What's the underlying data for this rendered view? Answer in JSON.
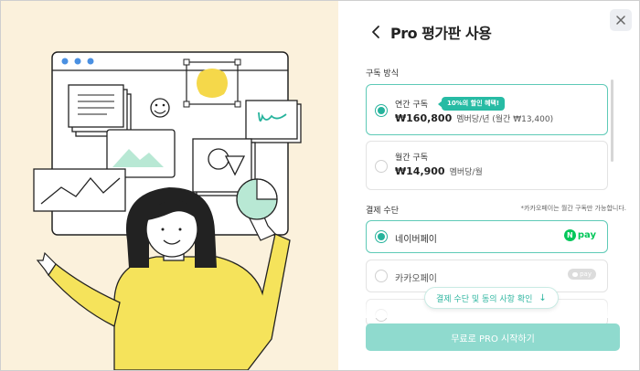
{
  "header": {
    "title": "Pro 평가판 사용"
  },
  "subscription": {
    "label": "구독 방식",
    "options": [
      {
        "name": "연간 구독",
        "badge": "10%의 할인 혜택!",
        "price": "₩160,800",
        "price_sub": "멤버당/년 (월간 ₩13,400)",
        "selected": true
      },
      {
        "name": "월간 구독",
        "price": "₩14,900",
        "price_sub": "멤버당/월",
        "selected": false
      }
    ]
  },
  "payment": {
    "label": "결제 수단",
    "note": "*카카오페이는 월간 구독만 가능합니다.",
    "methods": [
      {
        "name": "네이버페이",
        "logo_letter": "N",
        "logo_text": "pay",
        "selected": true
      },
      {
        "name": "카카오페이",
        "logo_text": "pay",
        "selected": false
      }
    ]
  },
  "hint": {
    "label": "결제 수단 및 동의 사항 확인",
    "icon": "arrow-down-icon"
  },
  "cta": {
    "label": "무료로 PRO 시작하기"
  },
  "colors": {
    "accent": "#26b39c",
    "cta_bg": "#8fdace",
    "illustration_bg": "#fbf1dc",
    "shirt": "#f5e35b",
    "naver_green": "#03c75a"
  }
}
